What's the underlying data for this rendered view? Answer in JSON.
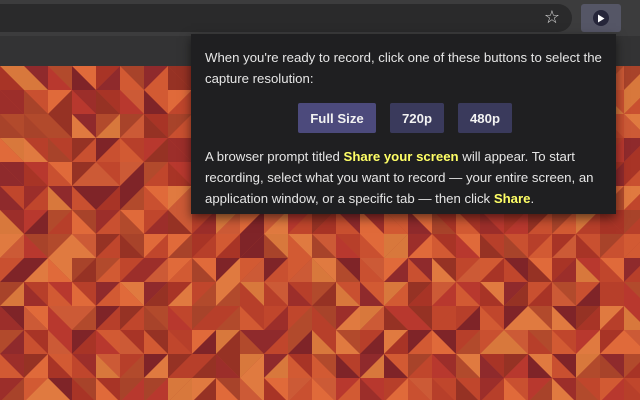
{
  "browser": {
    "bookmark_icon": "star-outline-icon",
    "extension_icon": "play-icon"
  },
  "popup": {
    "intro_text": "When you're ready to record, click one of these buttons to select the capture resolution:",
    "buttons": {
      "full_size": "Full Size",
      "r720": "720p",
      "r480": "480p"
    },
    "info": {
      "part1": "A browser prompt titled ",
      "highlight1": "Share your screen",
      "part2": " will appear. To start recording, select what you want to record — your entire screen, an application window, or a specific tab — then click ",
      "highlight2": "Share",
      "part3": "."
    }
  },
  "colors": {
    "accent_button": "#4c4a7c",
    "button": "#3a3a5c",
    "highlight": "#ffff66",
    "popup_bg": "#1f1f21"
  }
}
